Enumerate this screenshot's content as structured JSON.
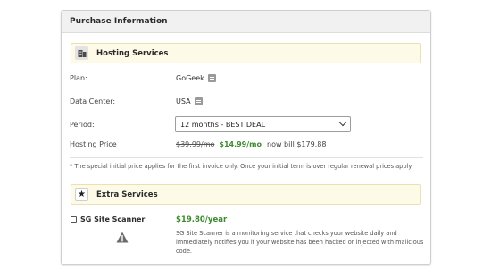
{
  "panel": {
    "title": "Purchase Information"
  },
  "hosting": {
    "section_title": "Hosting Services",
    "plan_label": "Plan:",
    "plan_value": "GoGeek",
    "datacenter_label": "Data Center:",
    "datacenter_value": "USA",
    "period_label": "Period:",
    "period_selected": "12 months - BEST DEAL",
    "price_label": "Hosting Price",
    "old_price": "$39.99/mo",
    "new_price": "$14.99/mo",
    "bill_text": "now bill $179.88"
  },
  "note": "* The special initial price applies for the first invoice only. Once your initial term is over regular renewal prices apply.",
  "extra": {
    "section_title": "Extra Services",
    "scanner_label": "SG Site Scanner",
    "scanner_price": "$19.80/year",
    "scanner_desc": "SG Site Scanner is a monitoring service that checks your website daily and immediately notifies you if your website has been hacked or injected with malicious code."
  },
  "colors": {
    "accent_green": "#3c8b2e",
    "section_bg": "#fdfbe7",
    "section_border": "#ecdfb1"
  }
}
